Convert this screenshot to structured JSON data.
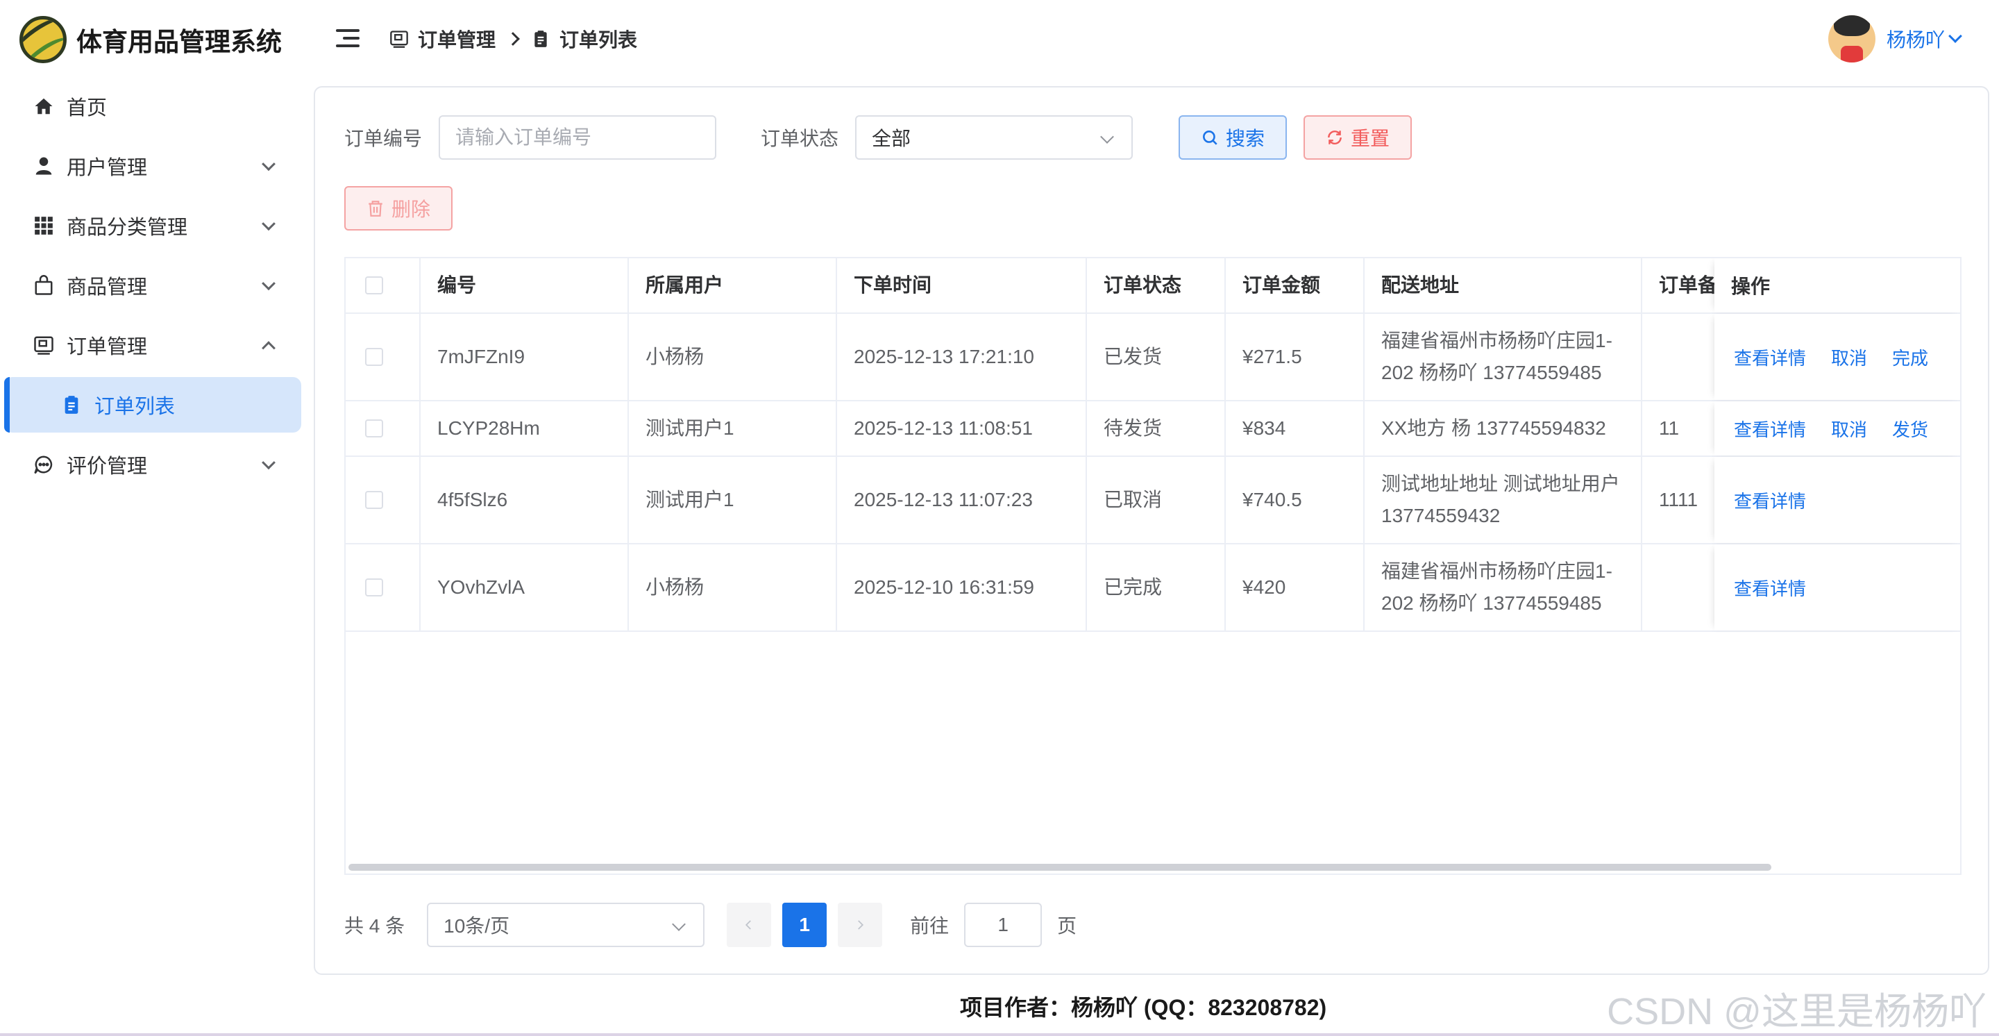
{
  "app": {
    "title": "体育用品管理系统"
  },
  "sidebar": {
    "items": [
      {
        "label": "首页"
      },
      {
        "label": "用户管理"
      },
      {
        "label": "商品分类管理"
      },
      {
        "label": "商品管理"
      },
      {
        "label": "订单管理"
      },
      {
        "label": "订单列表"
      },
      {
        "label": "评价管理"
      }
    ]
  },
  "header": {
    "breadcrumb": [
      "订单管理",
      "订单列表"
    ],
    "username": "杨杨吖"
  },
  "filter": {
    "order_no_label": "订单编号",
    "order_no_placeholder": "请输入订单编号",
    "status_label": "订单状态",
    "status_value": "全部",
    "search_label": "搜索",
    "reset_label": "重置",
    "delete_label": "删除"
  },
  "table": {
    "headers": [
      "编号",
      "所属用户",
      "下单时间",
      "订单状态",
      "订单金额",
      "配送地址",
      "订单备注",
      "操作"
    ],
    "rows": [
      {
        "no": "7mJFZnI9",
        "user": "小杨杨",
        "time": "2025-12-13 17:21:10",
        "status": "已发货",
        "amount": "¥271.5",
        "addr1": "福建省福州市杨杨吖庄园1-",
        "addr2": "202 杨杨吖 13774559485",
        "remark": "",
        "ops": [
          "查看详情",
          "取消",
          "完成"
        ]
      },
      {
        "no": "LCYP28Hm",
        "user": "测试用户1",
        "time": "2025-12-13 11:08:51",
        "status": "待发货",
        "amount": "¥834",
        "addr1": "XX地方 杨 137745594832",
        "addr2": "",
        "remark": "11",
        "ops": [
          "查看详情",
          "取消",
          "发货"
        ]
      },
      {
        "no": "4f5fSlz6",
        "user": "测试用户1",
        "time": "2025-12-13 11:07:23",
        "status": "已取消",
        "amount": "¥740.5",
        "addr1": "测试地址地址 测试地址用户",
        "addr2": "13774559432",
        "remark": "1111",
        "ops": [
          "查看详情"
        ]
      },
      {
        "no": "YOvhZvlA",
        "user": "小杨杨",
        "time": "2025-12-10 16:31:59",
        "status": "已完成",
        "amount": "¥420",
        "addr1": "福建省福州市杨杨吖庄园1-",
        "addr2": "202 杨杨吖 13774559485",
        "remark": "",
        "ops": [
          "查看详情"
        ]
      }
    ]
  },
  "pagination": {
    "total_text": "共 4 条",
    "page_size": "10条/页",
    "current_page": "1",
    "goto_label": "前往",
    "goto_value": "1",
    "page_suffix": "页"
  },
  "footer": {
    "text": "项目作者：杨杨吖 (QQ：823208782)"
  },
  "watermark": {
    "text": "CSDN @这里是杨杨吖"
  },
  "colors": {
    "accent": "#1a73e8",
    "danger": "#f25c5c",
    "active_bg": "#d6e6fb"
  }
}
